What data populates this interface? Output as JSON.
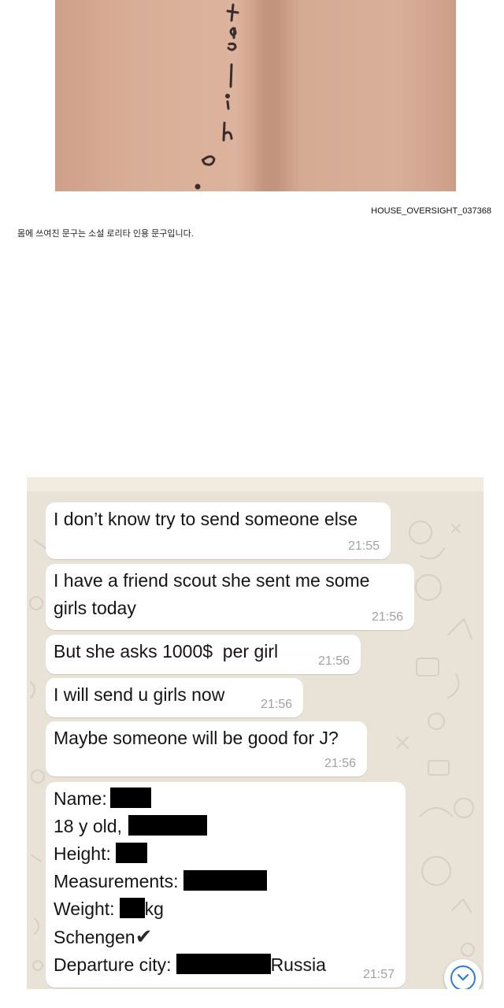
{
  "photo": {
    "alt_icon": "skin-tattoo-photo",
    "source_id": "HOUSE_OVERSIGHT_037368"
  },
  "caption": "몸에 쓰여진 문구는 소설 로리타 인용 문구입니다.",
  "chat": {
    "messages": [
      {
        "text": "I don’t know try to send someone else",
        "time": "21:55"
      },
      {
        "line1": "I have a friend scout she sent me some",
        "line2": "girls today",
        "time": "21:56"
      },
      {
        "text": "But she asks 1000$  per girl",
        "time": "21:56"
      },
      {
        "text": "I will send u girls now",
        "time": "21:56"
      },
      {
        "text": "Maybe someone will be good for J?",
        "time": "21:56"
      }
    ],
    "profile": {
      "name_label": "Name:",
      "age_label": "18 y old,",
      "height_label": "Height:",
      "measurements_label": "Measurements:",
      "weight_label": "Weight:",
      "weight_unit": "kg",
      "schengen_label": "Schengen",
      "schengen_mark": "✔",
      "departure_label": "Departure city:",
      "departure_country": "Russia",
      "time": "21:57"
    },
    "scroll_icon": "chevron-down-icon",
    "colors": {
      "background": "#e9e3d7",
      "bubble": "#ffffff",
      "accent": "#2f7bd8"
    }
  }
}
